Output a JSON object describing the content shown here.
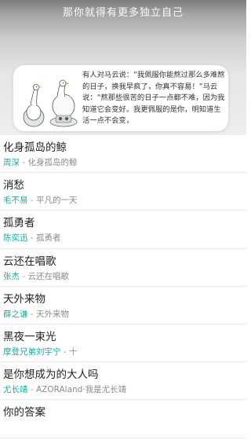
{
  "header": {
    "title": "那你就得有更多独立自己"
  },
  "quote": {
    "text": "有人对马云说：“我佩服你能熬过那么多难熬的日子，换我早疯了，你真不容易！”马云说：“熬那些很苦的日子一点都不难，因为我知道它会变好。我更佩服的是你，明知道生活一点不会变，"
  },
  "songs": [
    {
      "title": "化身孤岛的鲸",
      "artist": "周深",
      "separator": " - ",
      "album": "化身孤岛的鲸"
    },
    {
      "title": "消愁",
      "artist": "毛不易",
      "separator": " - ",
      "album": "平凡的一天"
    },
    {
      "title": "孤勇者",
      "artist": "陈奕迅",
      "separator": " - ",
      "album": "孤勇者"
    },
    {
      "title": "云还在唱歌",
      "artist": "张杰",
      "separator": " - ",
      "album": "云还在唱歌"
    },
    {
      "title": "天外来物",
      "artist": "薛之谦",
      "separator": " - ",
      "album": "天外来物"
    },
    {
      "title": "黑夜一束光",
      "artist": "摩登兄弟刘宇宁",
      "separator": " - ",
      "album": "十"
    },
    {
      "title": "是你想成为的大人吗",
      "artist": "尤长靖",
      "separator": " - ",
      "album": "AZORAland·我是尤长靖"
    },
    {
      "title": "你的答案",
      "artist": "",
      "separator": "",
      "album": ""
    }
  ]
}
